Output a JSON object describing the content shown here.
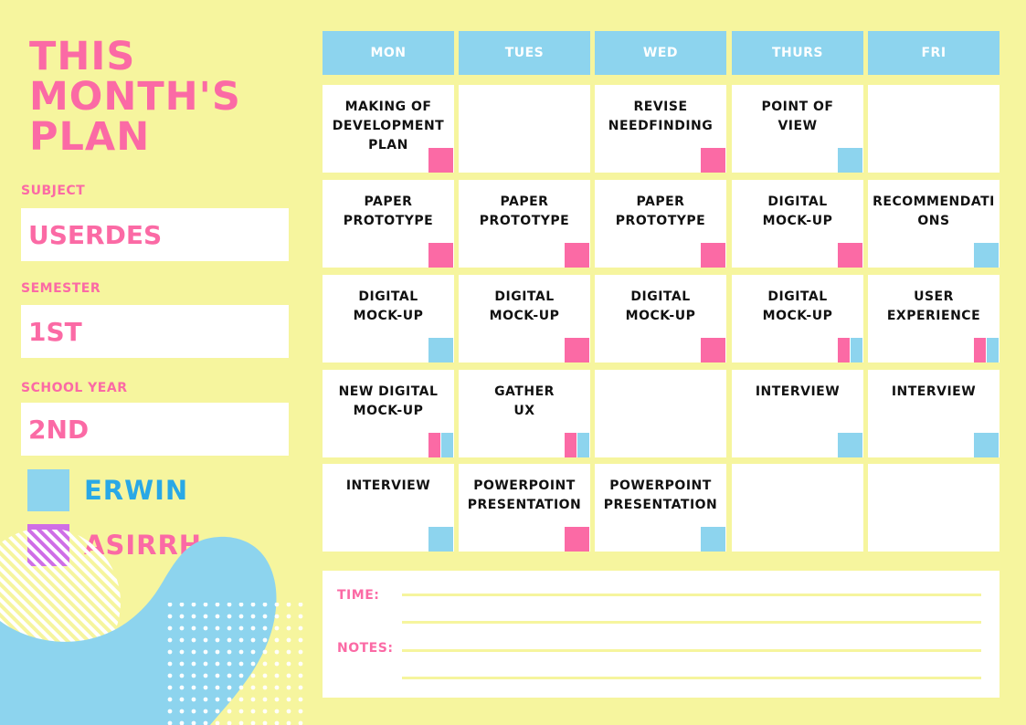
{
  "title": "THIS\nMONTH'S\nPLAN",
  "fields": [
    {
      "label": "SUBJECT",
      "value": "USERDES"
    },
    {
      "label": "SEMESTER",
      "value": "1ST"
    },
    {
      "label": "SCHOOL YEAR",
      "value": "2ND"
    }
  ],
  "legend": [
    {
      "name": "ERWIN",
      "color": "#8dd4ee",
      "text_color": "#29a8e6"
    },
    {
      "name": "ASIRRH",
      "color": "#cf6ee6",
      "text_color": "#fb6aa5"
    }
  ],
  "colors": {
    "background": "#f6f59e",
    "accent_pink": "#fb6aa5",
    "accent_blue": "#8dd4ee"
  },
  "days": [
    "MON",
    "TUES",
    "WED",
    "THURS",
    "FRI"
  ],
  "weeks": [
    [
      {
        "text": "MAKING OF\nDEVELOPMENT\nPLAN",
        "tags": [
          "pink"
        ]
      },
      {
        "text": "",
        "tags": []
      },
      {
        "text": "REVISE\nNEEDFINDING",
        "tags": [
          "pink"
        ]
      },
      {
        "text": "POINT OF\nVIEW",
        "tags": [
          "blue"
        ]
      },
      {
        "text": "",
        "tags": []
      }
    ],
    [
      {
        "text": "PAPER\nPROTOTYPE",
        "tags": [
          "pink"
        ]
      },
      {
        "text": "PAPER\nPROTOTYPE",
        "tags": [
          "pink"
        ]
      },
      {
        "text": "PAPER\nPROTOTYPE",
        "tags": [
          "pink"
        ]
      },
      {
        "text": "DIGITAL\nMOCK-UP",
        "tags": [
          "pink"
        ]
      },
      {
        "text": "RECOMMENDATI\nONS",
        "tags": [
          "blue"
        ]
      }
    ],
    [
      {
        "text": "DIGITAL\nMOCK-UP",
        "tags": [
          "blue"
        ]
      },
      {
        "text": "DIGITAL\nMOCK-UP",
        "tags": [
          "pink"
        ]
      },
      {
        "text": "DIGITAL\nMOCK-UP",
        "tags": [
          "pink"
        ]
      },
      {
        "text": "DIGITAL\nMOCK-UP",
        "tags": [
          "pink",
          "blue"
        ]
      },
      {
        "text": "USER\nEXPERIENCE",
        "tags": [
          "pink",
          "blue"
        ]
      }
    ],
    [
      {
        "text": "NEW DIGITAL\nMOCK-UP",
        "tags": [
          "pink",
          "blue"
        ]
      },
      {
        "text": "GATHER\nUX",
        "tags": [
          "pink",
          "blue"
        ]
      },
      {
        "text": "",
        "tags": []
      },
      {
        "text": "INTERVIEW",
        "tags": [
          "blue"
        ]
      },
      {
        "text": "INTERVIEW",
        "tags": [
          "blue"
        ]
      }
    ],
    [
      {
        "text": "INTERVIEW",
        "tags": [
          "blue"
        ]
      },
      {
        "text": "POWERPOINT\nPRESENTATION",
        "tags": [
          "pink"
        ]
      },
      {
        "text": "POWERPOINT\nPRESENTATION",
        "tags": [
          "blue"
        ]
      },
      {
        "text": "",
        "tags": []
      },
      {
        "text": "",
        "tags": []
      }
    ]
  ],
  "notes": {
    "time_label": "TIME:",
    "notes_label": "NOTES:"
  }
}
